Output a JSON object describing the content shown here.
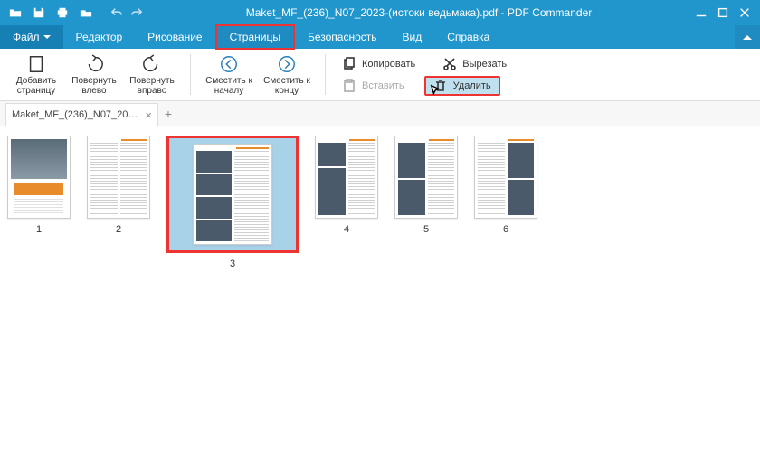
{
  "titlebar": {
    "title": "Maket_MF_(236)_N07_2023-(истоки ведьмака).pdf - PDF Commander"
  },
  "menu": {
    "file": "Файл",
    "items": [
      "Редактор",
      "Рисование",
      "Страницы",
      "Безопасность",
      "Вид",
      "Справка"
    ],
    "active_index": 2
  },
  "toolbar": {
    "add_page": "Добавить\nстраницу",
    "rotate_left": "Повернуть\nвлево",
    "rotate_right": "Повернуть\nвправо",
    "move_start": "Сместить к\nначалу",
    "move_end": "Сместить к\nконцу",
    "copy": "Копировать",
    "cut": "Вырезать",
    "paste": "Вставить",
    "delete": "Удалить"
  },
  "tab": {
    "name": "Maket_MF_(236)_N07_20…"
  },
  "pages": {
    "count": 6,
    "selected": 3,
    "labels": [
      "1",
      "2",
      "3",
      "4",
      "5",
      "6"
    ]
  }
}
